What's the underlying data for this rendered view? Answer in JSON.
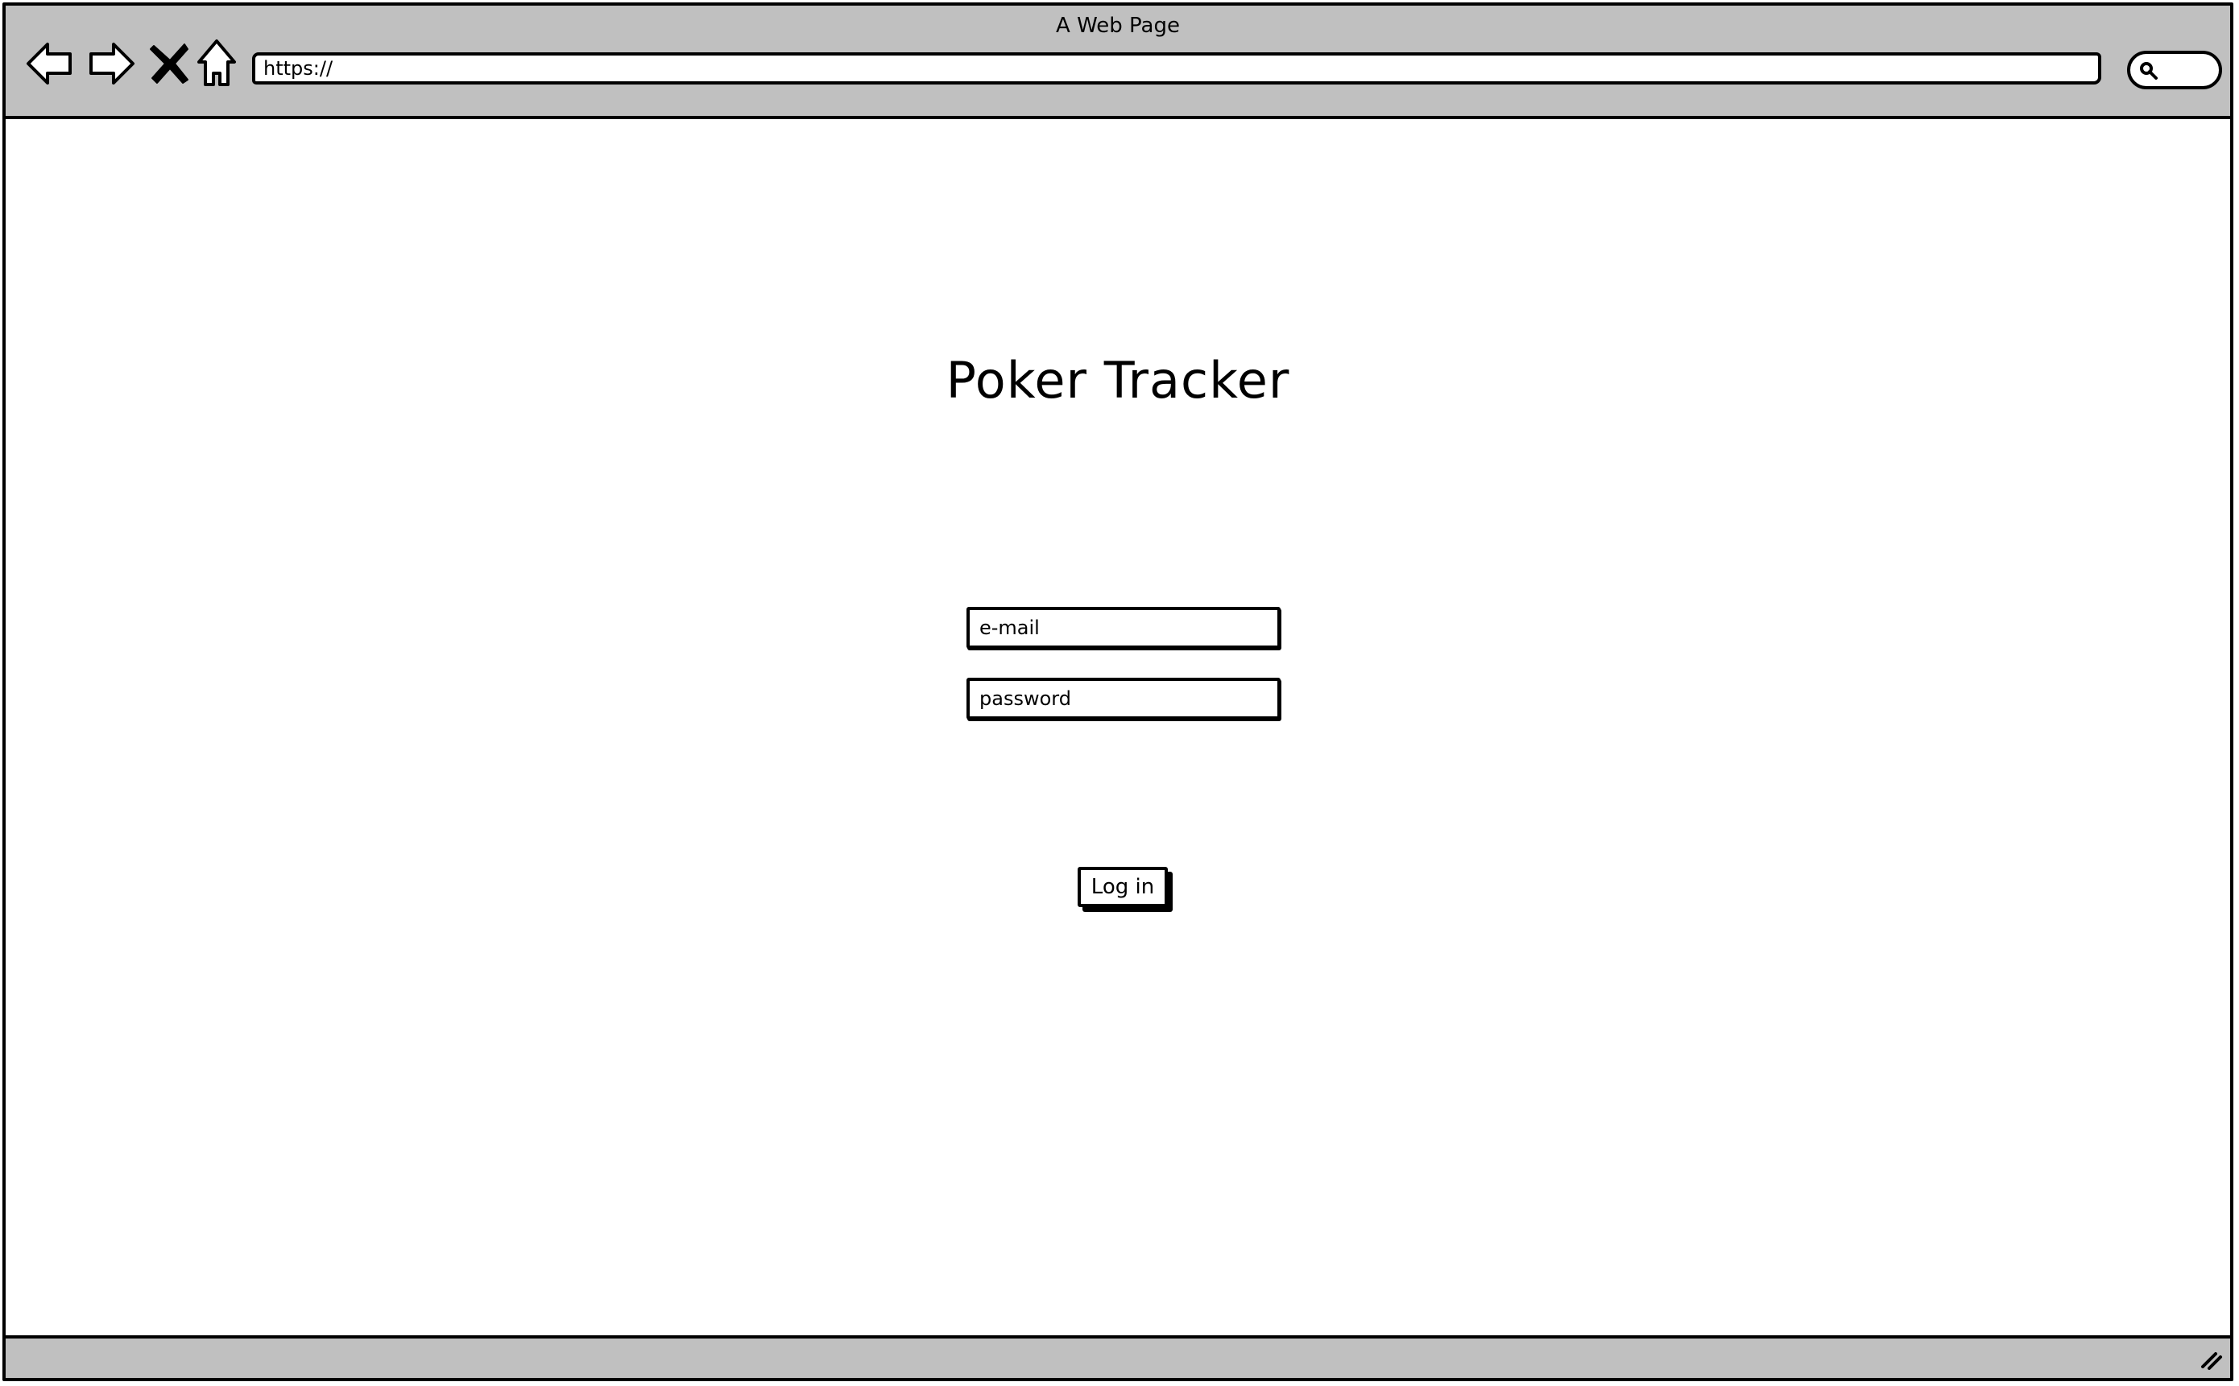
{
  "window": {
    "title": "A Web Page"
  },
  "toolbar": {
    "back_icon": "back-arrow-icon",
    "forward_icon": "forward-arrow-icon",
    "stop_icon": "close-icon",
    "home_icon": "home-icon",
    "address_value": "https://",
    "search_icon": "search-icon"
  },
  "main": {
    "title": "Poker Tracker",
    "email_placeholder": "e-mail",
    "password_placeholder": "password",
    "login_label": "Log in"
  },
  "statusbar": {
    "resize_icon": "resize-grip-icon"
  }
}
